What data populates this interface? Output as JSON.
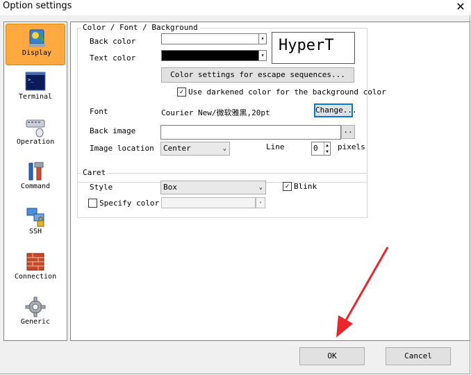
{
  "window": {
    "title": "Option settings",
    "close_glyph": "✕"
  },
  "sidebar": {
    "items": [
      {
        "label": "Display",
        "icon": "display-icon",
        "selected": true
      },
      {
        "label": "Terminal",
        "icon": "terminal-icon"
      },
      {
        "label": "Operation",
        "icon": "mouse-icon"
      },
      {
        "label": "Command",
        "icon": "tools-icon"
      },
      {
        "label": "SSH",
        "icon": "ssh-network-icon"
      },
      {
        "label": "Connection",
        "icon": "firewall-icon"
      },
      {
        "label": "Generic",
        "icon": "gear-icon"
      }
    ]
  },
  "cfb": {
    "legend": "Color / Font / Background",
    "back_color_label": "Back color",
    "back_color_value": "#ffffff",
    "text_color_label": "Text color",
    "text_color_value": "#000000",
    "preview_text": "HyperT",
    "escape_button": "Color settings for escape sequences...",
    "darken_checkbox": "Use darkened color for the background color",
    "darken_checked": true,
    "font_label": "Font",
    "font_value": "Courier New/微软雅黑,20pt",
    "change_button": "Change...",
    "back_image_label": "Back image",
    "back_image_value": "",
    "browse_button": "..",
    "image_location_label": "Image location",
    "image_location_value": "Center",
    "line_label": "Line",
    "line_value": "0",
    "pixels_label": "pixels"
  },
  "caret": {
    "legend": "Caret",
    "style_label": "Style",
    "style_value": "Box",
    "blink_label": "Blink",
    "blink_checked": true,
    "specify_color_label": "Specify color",
    "specify_color_checked": false
  },
  "footer": {
    "ok": "OK",
    "cancel": "Cancel"
  }
}
